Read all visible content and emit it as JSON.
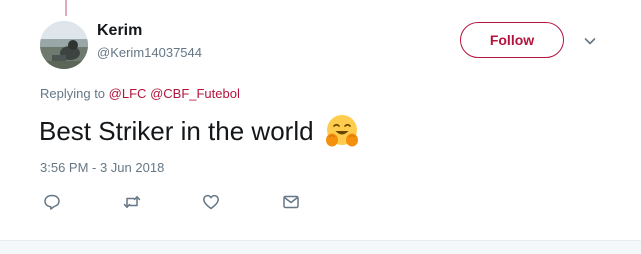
{
  "author": {
    "name": "Kerim",
    "handle": "@Kerim14037544",
    "avatar_icon": "profile-photo"
  },
  "follow_button": {
    "label": "Follow",
    "color": "#b3143d"
  },
  "menu": {
    "icon": "chevron-down-icon"
  },
  "replying": {
    "prefix": "Replying to",
    "mentions": [
      "@LFC",
      "@CBF_Futebol"
    ]
  },
  "tweet": {
    "text": "Best Striker in the world",
    "emoji_icon": "hugging-face-emoji"
  },
  "timestamp": "3:56 PM - 3 Jun 2018",
  "actions": [
    {
      "name": "reply",
      "icon": "reply-icon"
    },
    {
      "name": "retweet",
      "icon": "retweet-icon"
    },
    {
      "name": "like",
      "icon": "heart-icon"
    },
    {
      "name": "message",
      "icon": "envelope-icon"
    }
  ],
  "colors": {
    "accent": "#b3143d",
    "secondary_text": "#657786",
    "primary_text": "#14171a",
    "icon": "#657786"
  }
}
